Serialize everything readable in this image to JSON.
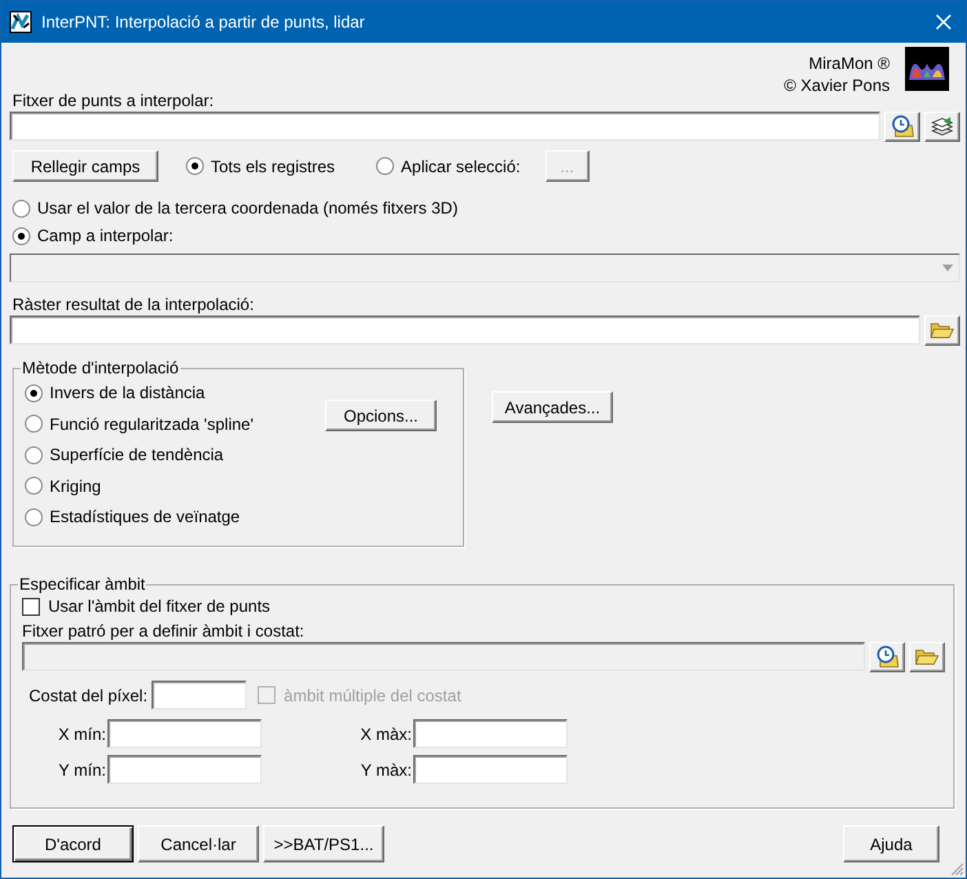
{
  "window": {
    "title": "InterPNT: Interpolació a partir de punts, lidar"
  },
  "brand": {
    "name": "MiraMon ®",
    "copyright": "© Xavier Pons"
  },
  "points_file": {
    "label": "Fitxer de punts a interpolar:"
  },
  "records": {
    "reload_button": "Rellegir camps",
    "radios": [
      {
        "label": "Tots els registres",
        "selected": true
      },
      {
        "label": "Aplicar selecció:",
        "selected": false
      }
    ],
    "selection_button": {
      "label": "...",
      "disabled": true
    }
  },
  "value_source": [
    {
      "label": "Usar el valor de la tercera coordenada (només fitxers 3D)",
      "selected": false
    },
    {
      "label": "Camp a interpolar:",
      "selected": true
    }
  ],
  "field_combo": {
    "disabled": true
  },
  "output_raster": {
    "label": "Ràster resultat de la interpolació:"
  },
  "method": {
    "title": "Mètode d'interpolació",
    "options": [
      {
        "label": "Invers de la distància",
        "selected": true
      },
      {
        "label": "Funció regularitzada 'spline'",
        "selected": false
      },
      {
        "label": "Superfície de tendència",
        "selected": false
      },
      {
        "label": "Kriging",
        "selected": false
      },
      {
        "label": "Estadístiques de veïnatge",
        "selected": false
      }
    ],
    "options_button": "Opcions...",
    "advanced_button": "Avançades..."
  },
  "extent": {
    "title": "Especificar àmbit",
    "use_points_extent": {
      "label": "Usar l'àmbit del fitxer de punts",
      "checked": false
    },
    "pattern_file": {
      "label": "Fitxer patró per a definir àmbit i costat:",
      "disabled": true
    },
    "pixel_size": {
      "label": "Costat del píxel:"
    },
    "multiple": {
      "label": "àmbit múltiple del costat",
      "checked": false,
      "disabled": true
    },
    "coords": [
      {
        "label": "X mín:"
      },
      {
        "label": "X màx:"
      },
      {
        "label": "Y mín:"
      },
      {
        "label": "Y màx:"
      }
    ]
  },
  "buttons": [
    {
      "label": "D'acord",
      "default": true
    },
    {
      "label": "Cancel·lar",
      "default": false
    },
    {
      "label": ">>BAT/PS1...",
      "default": false
    }
  ],
  "help_button": "Ajuda"
}
